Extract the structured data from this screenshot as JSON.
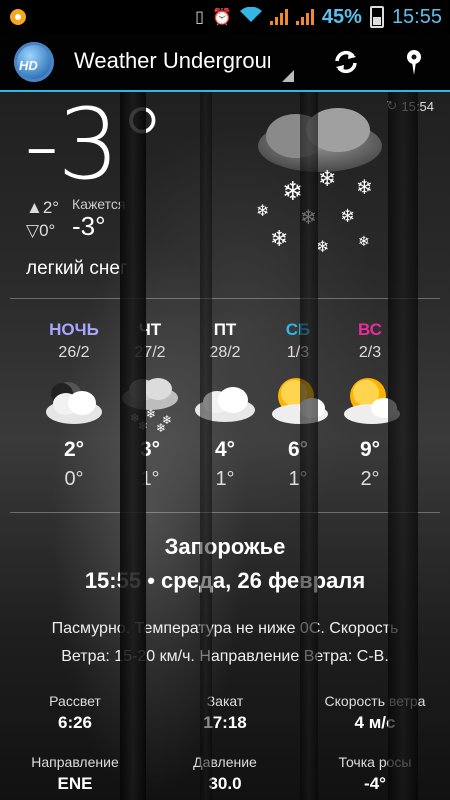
{
  "status_bar": {
    "battery_percent": "45%",
    "time": "15:55",
    "icons": [
      "notification-icon",
      "vibrate-icon",
      "alarm-icon",
      "wifi-icon",
      "signal-icon",
      "signal-icon",
      "battery-icon"
    ]
  },
  "app_bar": {
    "logo_text": "HD",
    "title": "Weather Underground",
    "refresh_icon": "refresh-icon",
    "location_icon": "location-pin-icon"
  },
  "current": {
    "updated_time": "15:54",
    "temperature": "-3°",
    "high": "▲2°",
    "low": "▽0°",
    "feels_like_label": "Кажется",
    "feels_like_value": "-3°",
    "condition": "легкий снег",
    "icon": "snow-cloud-icon"
  },
  "forecast": [
    {
      "day": "НОЧЬ",
      "date": "26/2",
      "icon": "night-cloud-icon",
      "high": "2°",
      "low": "0°",
      "color": "#a9a6ff"
    },
    {
      "day": "ЧТ",
      "date": "27/2",
      "icon": "snow-cloud-icon",
      "high": "3°",
      "low": "1°",
      "color": "#ffffff"
    },
    {
      "day": "ПТ",
      "date": "28/2",
      "icon": "cloud-icon",
      "high": "4°",
      "low": "1°",
      "color": "#ffffff"
    },
    {
      "day": "СБ",
      "date": "1/3",
      "icon": "partly-sunny-icon",
      "high": "6°",
      "low": "1°",
      "color": "#33b5e5"
    },
    {
      "day": "ВС",
      "date": "2/3",
      "icon": "partly-sunny-icon",
      "high": "9°",
      "low": "2°",
      "color": "#e62e9a"
    }
  ],
  "location": {
    "city": "Запорожье",
    "time": "15:55",
    "date": "среда, 26 февраля",
    "description_line1": "Пасмурно. Температура не ниже 0С. Скорость",
    "description_line2": "Ветра: 15-20 км/ч. Направление Ветра: С-В."
  },
  "details": [
    {
      "label": "Рассвет",
      "value": "6:26"
    },
    {
      "label": "Закат",
      "value": "17:18"
    },
    {
      "label": "Скорость ветра",
      "value": "4 м/с"
    },
    {
      "label": "Направление",
      "value": "ENE"
    },
    {
      "label": "Давление",
      "value": "30.0"
    },
    {
      "label": "Точка росы",
      "value": "-4°"
    }
  ],
  "colors": {
    "accent": "#33b5e5",
    "weekend_saturday": "#33b5e5",
    "weekend_sunday": "#e62e9a",
    "night": "#a9a6ff",
    "status_orange": "#f08a2a"
  }
}
